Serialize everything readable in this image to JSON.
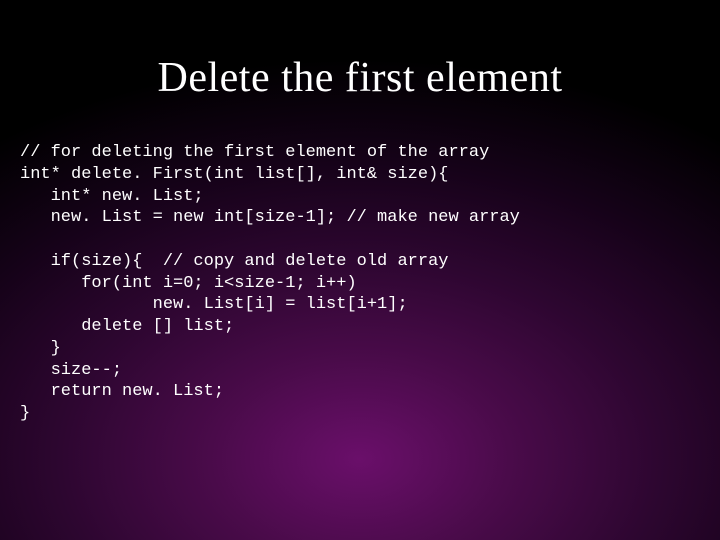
{
  "title": "Delete the first element",
  "code": {
    "l1": "// for deleting the first element of the array",
    "l2": "int* delete. First(int list[], int& size){",
    "l3": "   int* new. List;",
    "l4": "   new. List = new int[size-1]; // make new array",
    "l5": "",
    "l6": "   if(size){  // copy and delete old array",
    "l7": "      for(int i=0; i<size-1; i++)",
    "l8": "             new. List[i] = list[i+1];",
    "l9": "      delete [] list;",
    "l10": "   }",
    "l11": "   size--;",
    "l12": "   return new. List;",
    "l13": "}"
  }
}
